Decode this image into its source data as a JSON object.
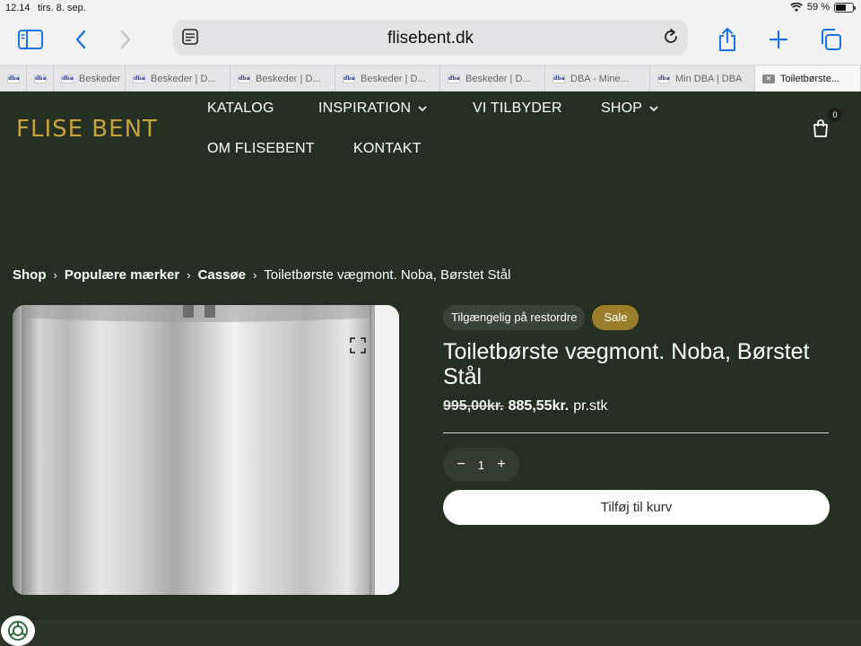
{
  "status_bar": {
    "time": "12.14",
    "date": "tirs. 8. sep.",
    "battery": "59 %",
    "battery_level": 0.59
  },
  "browser": {
    "url": "flisebent.dk",
    "tabs": [
      {
        "favicon": "dba",
        "label": ""
      },
      {
        "favicon": "dba",
        "label": ""
      },
      {
        "favicon": "dba",
        "label": "Beskeder"
      },
      {
        "favicon": "dba",
        "label": "Beskeder | D..."
      },
      {
        "favicon": "dba",
        "label": "Beskeder | D..."
      },
      {
        "favicon": "dba",
        "label": "Beskeder | D..."
      },
      {
        "favicon": "dba",
        "label": "Beskeder | D..."
      },
      {
        "favicon": "dba",
        "label": "DBA - Mine..."
      },
      {
        "favicon": "dba",
        "label": "Min DBA | DBA"
      },
      {
        "favicon": "close",
        "label": "Toiletbørste..."
      }
    ]
  },
  "site": {
    "logo": "FLISE BENT",
    "nav": [
      {
        "label": "KATALOG",
        "dropdown": false
      },
      {
        "label": "INSPIRATION",
        "dropdown": true
      },
      {
        "label": "VI TILBYDER",
        "dropdown": false
      },
      {
        "label": "SHOP",
        "dropdown": true
      },
      {
        "label": "OM FLISEBENT",
        "dropdown": false
      },
      {
        "label": "KONTAKT",
        "dropdown": false
      }
    ],
    "cart_count": "0"
  },
  "breadcrumb": {
    "items": [
      "Shop",
      "Populære mærker",
      "Cassøe"
    ],
    "current": "Toiletbørste vægmont. Noba, Børstet Stål"
  },
  "product": {
    "badge_stock": "Tilgængelig på restordre",
    "badge_sale": "Sale",
    "title": "Toiletbørste vægmont. Noba, Børstet Stål",
    "price_old": "995,00kr.",
    "price_new": "885,55kr.",
    "price_unit": "pr.stk",
    "quantity": "1",
    "add_to_cart": "Tilføj til kurv"
  },
  "colors": {
    "background": "#263022",
    "logo": "#c4a23c",
    "sale_badge": "#9b7e2a",
    "safari_accent": "#1a73e8"
  }
}
